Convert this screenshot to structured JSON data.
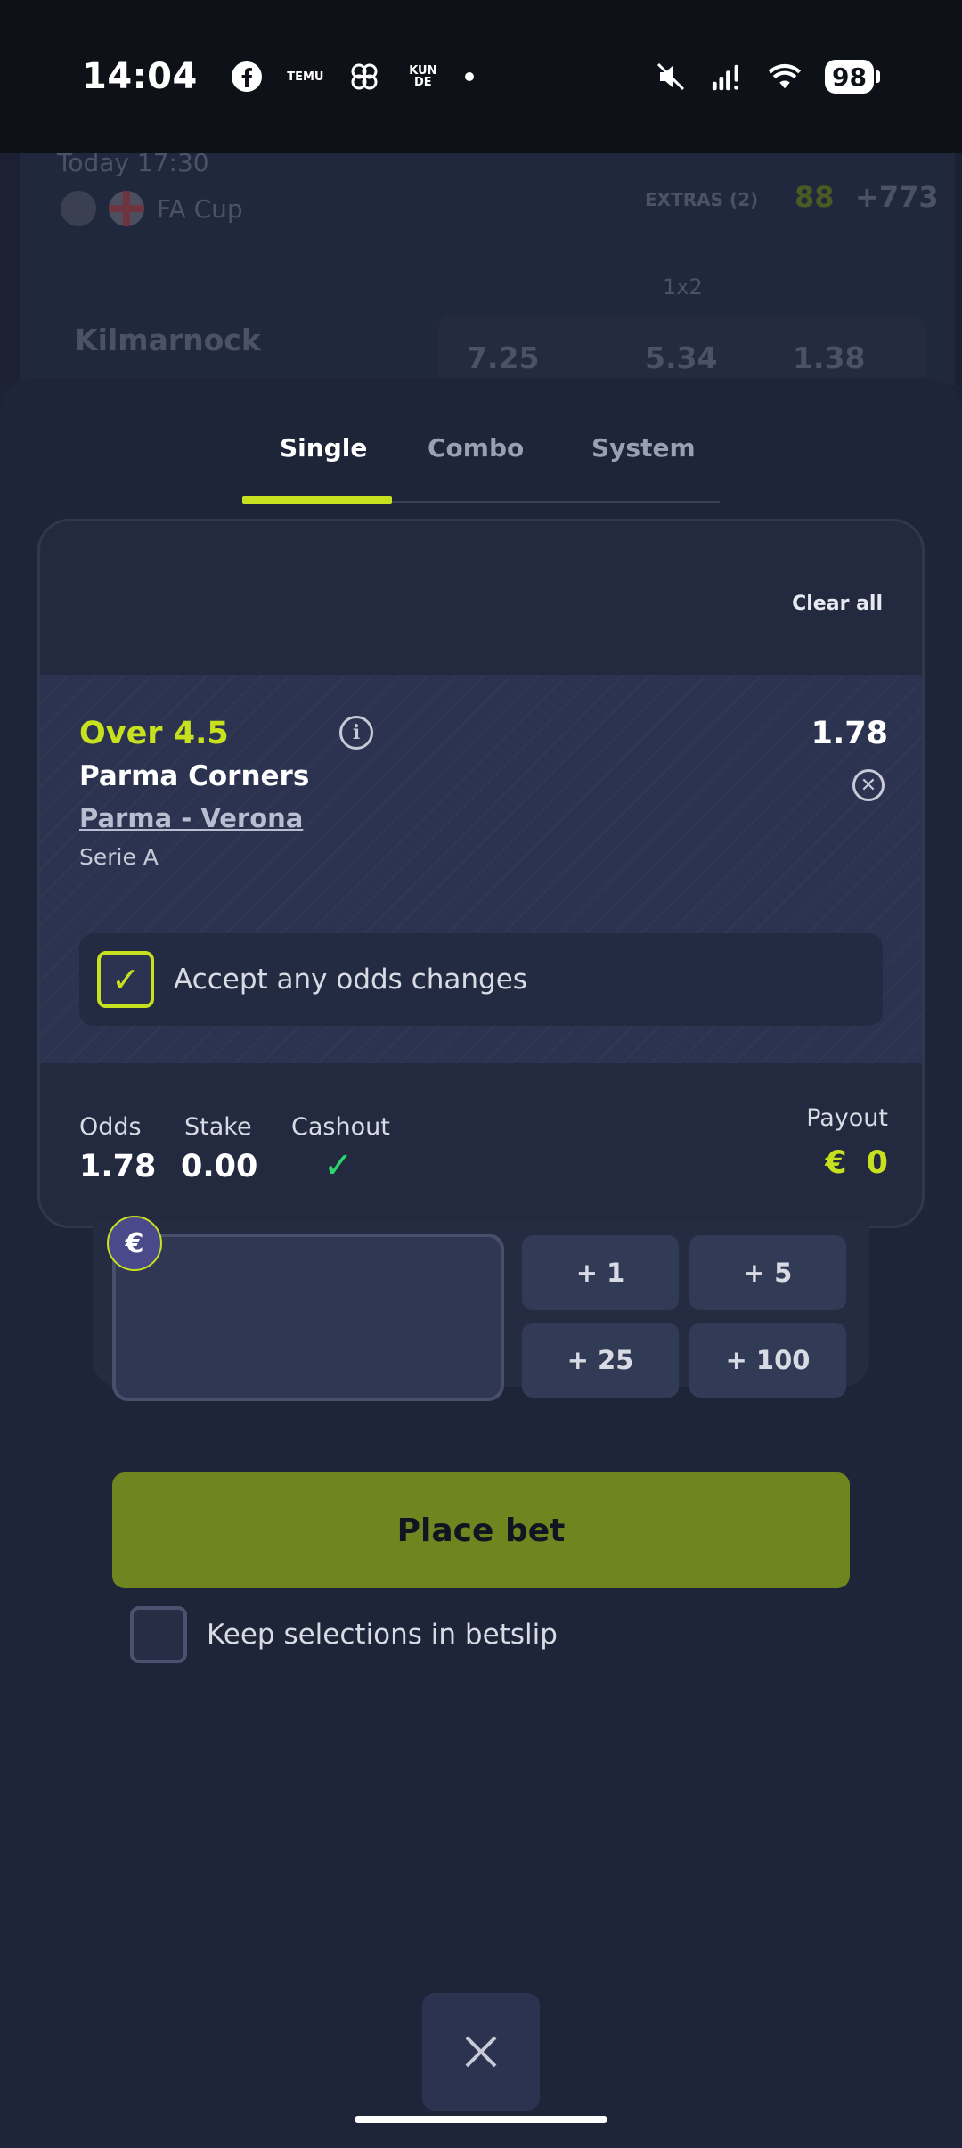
{
  "status_bar": {
    "time": "14:04",
    "icons_left": [
      "facebook-icon",
      "temu-icon",
      "pinwheel-icon",
      "kunde-icon",
      "dot-icon"
    ],
    "temu_text": "TEMU",
    "kunde_text": "KUN DE",
    "battery": "98"
  },
  "background_event": {
    "time": "Today 17:30",
    "league": "FA Cup",
    "extras": "EXTRAS (2)",
    "score_a": "88",
    "score_b": "+773",
    "market": "1x2",
    "team": "Kilmarnock",
    "odds": [
      "7.25",
      "5.34",
      "1.38"
    ]
  },
  "tabs": [
    {
      "label": "Single",
      "active": true
    },
    {
      "label": "Combo",
      "active": false
    },
    {
      "label": "System",
      "active": false
    }
  ],
  "betslip": {
    "clear_all": "Clear all",
    "selection": {
      "market": "Over 4.5",
      "outcome": "Parma Corners",
      "event": "Parma - Verona",
      "league": "Serie A",
      "odds": "1.78"
    },
    "accept_odds_label": "Accept any odds changes",
    "accept_odds_checked": true,
    "summary": {
      "odds_label": "Odds",
      "odds_value": "1.78",
      "stake_label": "Stake",
      "stake_value": "0.00",
      "cashout_label": "Cashout",
      "payout_label": "Payout",
      "payout_currency": "€",
      "payout_value": "0"
    }
  },
  "stake": {
    "currency": "€",
    "quick_amounts": [
      "+ 1",
      "+ 5",
      "+ 25",
      "+ 100"
    ]
  },
  "place_bet_label": "Place bet",
  "keep_selections_label": "Keep selections in betslip",
  "colors": {
    "accent": "#c8e11f",
    "place_bet": "#6f8520",
    "cashout_check": "#2fd46d",
    "background": "#1e2539"
  }
}
